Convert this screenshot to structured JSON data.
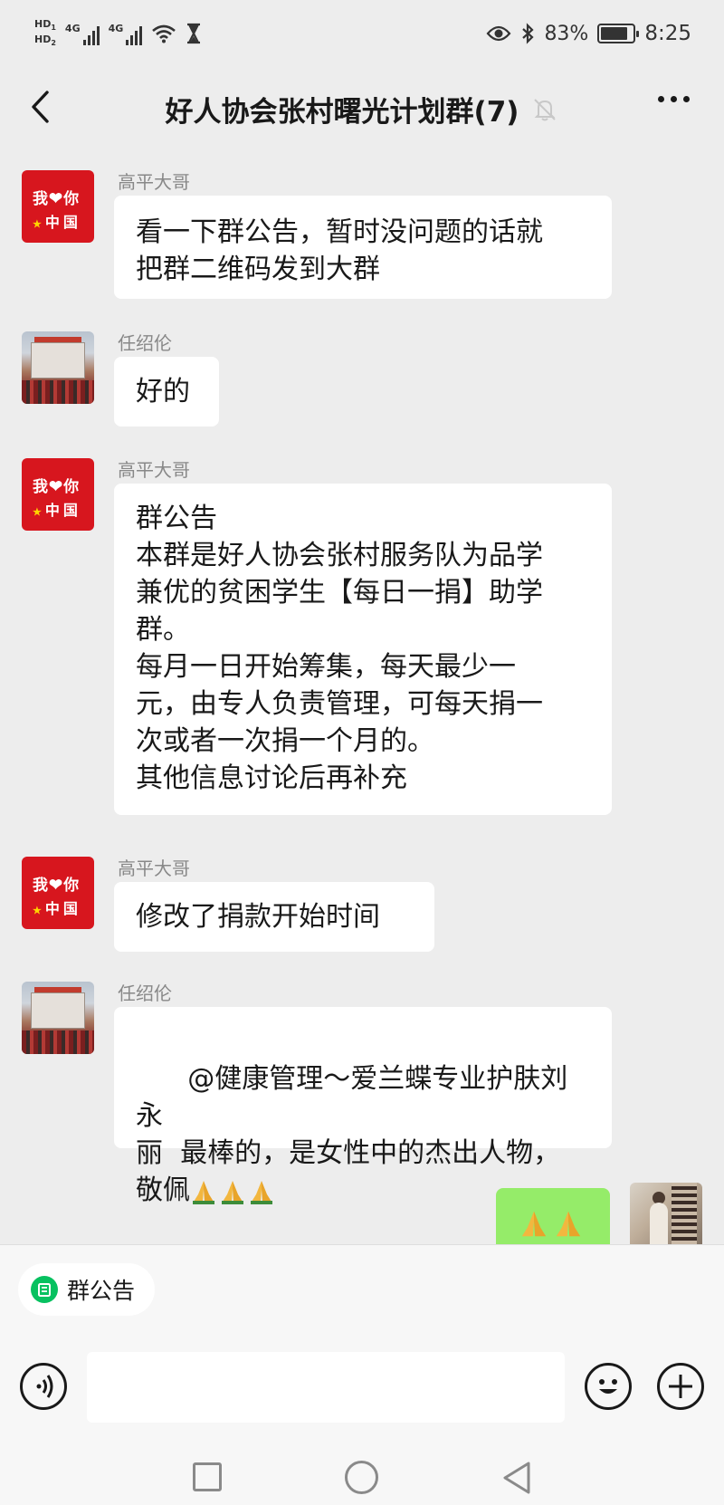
{
  "status_bar": {
    "hd1": "HD",
    "hd1_sub": "1",
    "hd2": "HD",
    "hd2_sub": "2",
    "net1": "4G",
    "net2": "4G",
    "battery_percent": "83%",
    "battery_level": 0.83,
    "time": "8:25",
    "icons": [
      "signal-icon",
      "wifi-icon",
      "hourglass-icon",
      "eye-icon",
      "bluetooth-icon",
      "battery-icon"
    ]
  },
  "header": {
    "title": "好人协会张村曙光计划群(7)",
    "back_icon": "chevron-left-icon",
    "mute_icon": "bell-muted-icon",
    "more_icon": "more-dots-icon"
  },
  "messages": [
    {
      "sender": "高平大哥",
      "avatar": "love-china-avatar",
      "text": "看一下群公告，暂时没问题的话就\n把群二维码发到大群"
    },
    {
      "sender": "任绍伦",
      "avatar": "group-photo-avatar",
      "text": "好的"
    },
    {
      "sender": "高平大哥",
      "avatar": "love-china-avatar",
      "text": "群公告\n本群是好人协会张村服务队为品学\n兼优的贫困学生【每日一捐】助学\n群。\n每月一日开始筹集，每天最少一\n元，由专人负责管理，可每天捐一\n次或者一次捐一个月的。\n其他信息讨论后再补充"
    },
    {
      "sender": "高平大哥",
      "avatar": "love-china-avatar",
      "text": "修改了捐款开始时间"
    },
    {
      "sender": "任绍伦",
      "avatar": "group-photo-avatar",
      "text": "@健康管理～爱兰蝶专业护肤刘永\n丽  最棒的，是女性中的杰出人物，\n敬佩",
      "emoji": [
        "folded-hands-emoji",
        "folded-hands-emoji",
        "folded-hands-emoji"
      ]
    },
    {
      "sender": "self",
      "avatar": "self-photo-avatar",
      "emoji": [
        "folded-hands-emoji",
        "folded-hands-emoji"
      ]
    }
  ],
  "love_avatar_text": {
    "line1_a": "我",
    "line1_b": "你",
    "line2": "中国"
  },
  "bottom": {
    "notice_chip_label": "群公告",
    "input_placeholder": "",
    "voice_icon": "voice-icon",
    "emoji_icon": "smiley-icon",
    "plus_icon": "plus-icon"
  },
  "colors": {
    "background": "#ededed",
    "bubble": "#ffffff",
    "self_bubble": "#95ec69",
    "accent_green": "#07c160",
    "avatar_red": "#d7161e"
  }
}
